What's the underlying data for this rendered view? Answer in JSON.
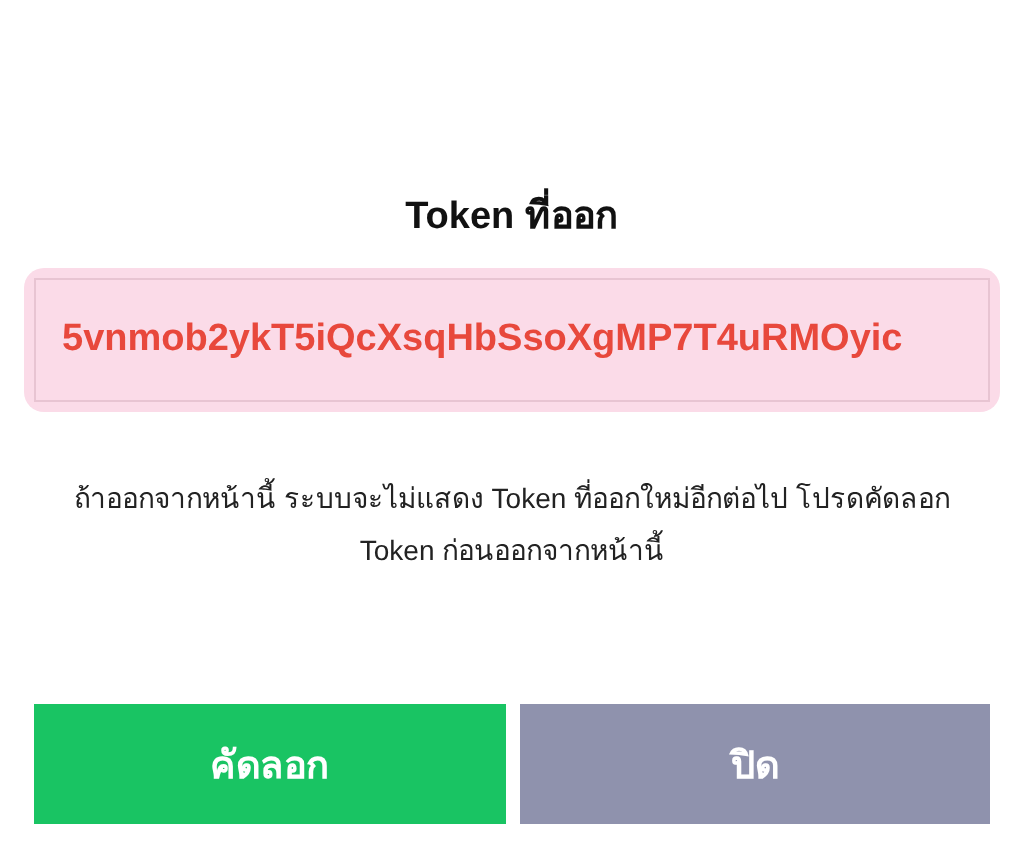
{
  "dialog": {
    "title": "Token ที่ออก",
    "token": "5vnmob2ykT5iQcXsqHbSsoXgMP7T4uRMOyic",
    "message": "ถ้าออกจากหน้านี้ ระบบจะไม่แสดง Token ที่ออกใหม่อีกต่อไป โปรดคัดลอก Token ก่อนออกจากหน้านี้",
    "buttons": [
      {
        "label": "คัดลอก",
        "kind": "primary"
      },
      {
        "label": "ปิด",
        "kind": "secondary"
      }
    ]
  }
}
